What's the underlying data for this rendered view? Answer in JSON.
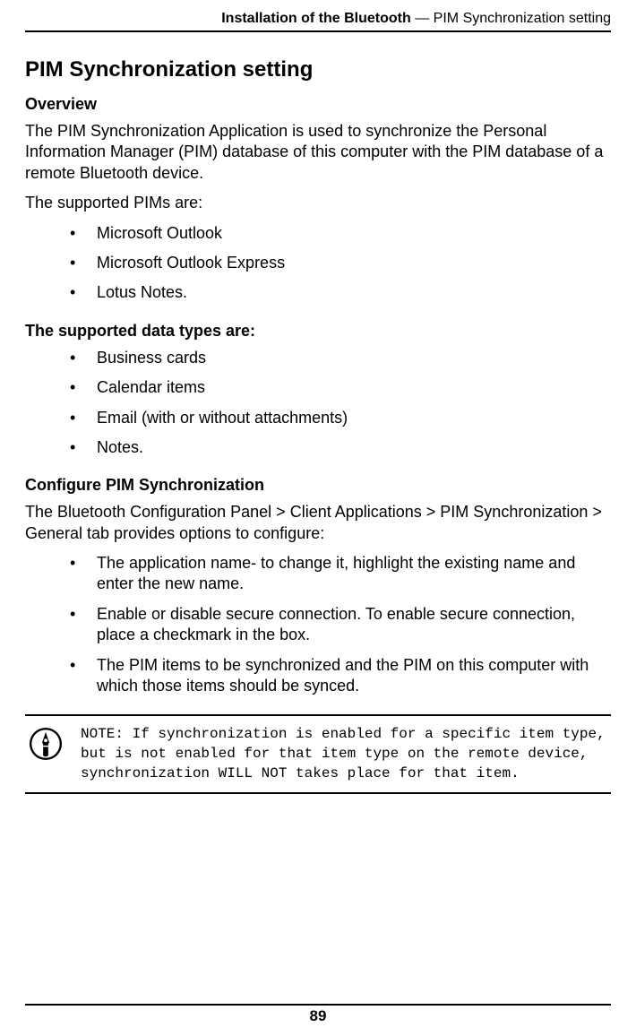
{
  "header": {
    "bold_part": "Installation of the Bluetooth",
    "separator": " — ",
    "rest": "PIM Synchronization setting"
  },
  "title": "PIM Synchronization setting",
  "overview": {
    "heading": "Overview",
    "para1": "The PIM Synchronization Application is used to synchronize the Personal Information Manager (PIM) database of this computer with the PIM database of a remote Bluetooth device.",
    "para2": "The supported PIMs are:",
    "list": [
      "Microsoft Outlook",
      "Microsoft Outlook Express",
      "Lotus Notes."
    ]
  },
  "data_types": {
    "heading": "The supported data types are:",
    "list": [
      "Business cards",
      "Calendar items",
      "Email (with or without attachments)",
      "Notes."
    ]
  },
  "configure": {
    "heading": "Configure PIM Synchronization",
    "para1": "The Bluetooth Configuration Panel > Client Applications > PIM Synchronization > General tab provides options to configure:",
    "list": [
      "The application name- to change it, highlight the existing name and enter the new name.",
      "Enable or disable secure connection. To enable secure connection, place a checkmark in the box.",
      "The PIM items to be synchronized and the PIM on this computer with which those items should be synced."
    ]
  },
  "note": {
    "text": "NOTE: If synchronization is enabled for a specific item type, but is not enabled for that item type on the remote device, synchronization WILL NOT takes place for that item."
  },
  "page_number": "89"
}
